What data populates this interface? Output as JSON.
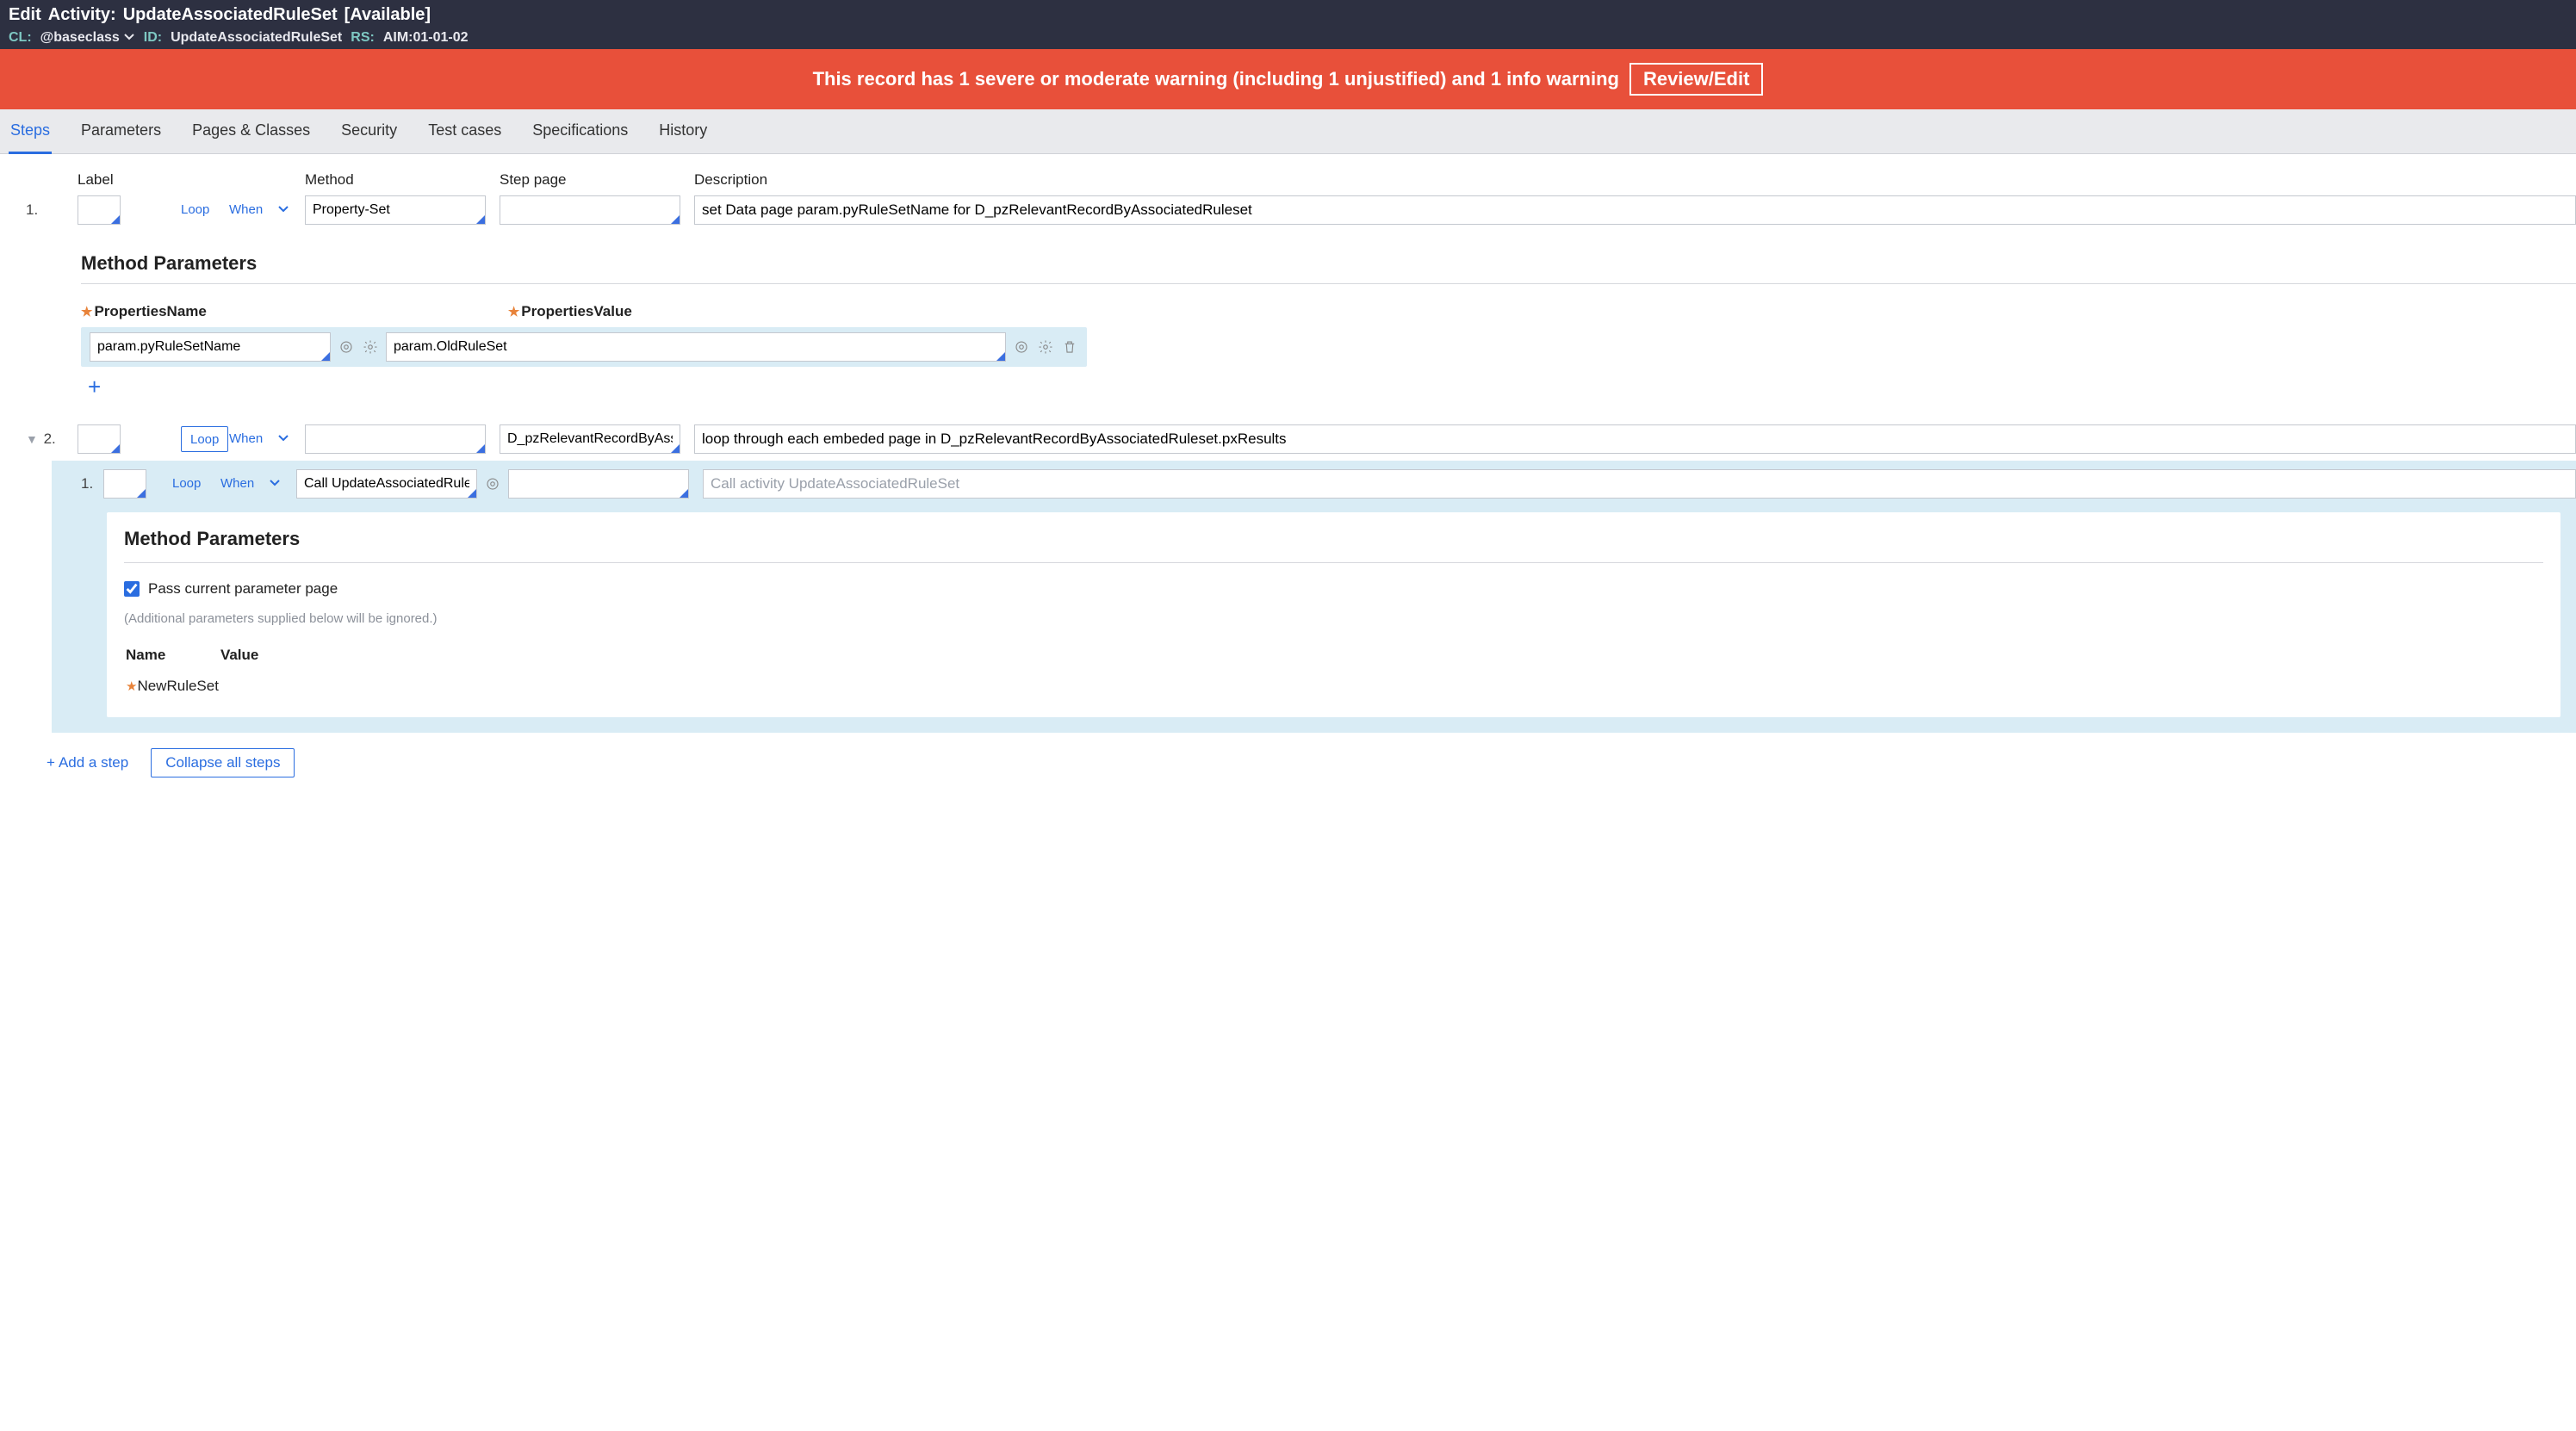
{
  "header": {
    "edit_label": "Edit",
    "rule_type": "Activity:",
    "rule_name": "UpdateAssociatedRuleSet",
    "status": "[Available]",
    "cl_label": "CL:",
    "cl_value": "@baseclass",
    "id_label": "ID:",
    "id_value": "UpdateAssociatedRuleSet",
    "rs_label": "RS:",
    "rs_value": "AIM:01-01-02"
  },
  "warning": {
    "text": "This record has 1 severe or moderate warning (including 1 unjustified) and 1 info warning",
    "review_label": "Review/Edit"
  },
  "tabs": [
    "Steps",
    "Parameters",
    "Pages & Classes",
    "Security",
    "Test cases",
    "Specifications",
    "History"
  ],
  "active_tab": "Steps",
  "columns": {
    "label": "Label",
    "method": "Method",
    "step_page": "Step page",
    "description": "Description"
  },
  "step1": {
    "num": "1.",
    "loop": "Loop",
    "when": "When",
    "method": "Property-Set",
    "step_page": "",
    "description": "set Data page param.pyRuleSetName for D_pzRelevantRecordByAssociatedRuleset"
  },
  "method_params_title": "Method Parameters",
  "mp_labels": {
    "name": "PropertiesName",
    "value": "PropertiesValue"
  },
  "mp_row": {
    "name": "param.pyRuleSetName",
    "value": "param.OldRuleSet"
  },
  "step2": {
    "num": "2.",
    "loop": "Loop",
    "when": "When",
    "method": "",
    "step_page": "D_pzRelevantRecordByAssociatedRuleset.pxResults",
    "description": "loop through each embeded page in D_pzRelevantRecordByAssociatedRuleset.pxResults"
  },
  "step2_child": {
    "num": "1.",
    "loop": "Loop",
    "when": "When",
    "method": "Call UpdateAssociatedRuleSet",
    "method_display": "Call UpdateAssociatedRuleS",
    "step_page": "",
    "desc_placeholder": "Call activity UpdateAssociatedRuleSet"
  },
  "child_mp": {
    "title": "Method Parameters",
    "pass_param_label": "Pass current parameter page",
    "pass_param_checked": true,
    "hint": "(Additional parameters supplied below will be ignored.)",
    "table_headers": {
      "name": "Name",
      "value": "Value"
    },
    "rows": [
      {
        "name": "NewRuleSet",
        "value": ""
      }
    ]
  },
  "footer": {
    "add_step": "Add a step",
    "collapse": "Collapse all steps"
  }
}
